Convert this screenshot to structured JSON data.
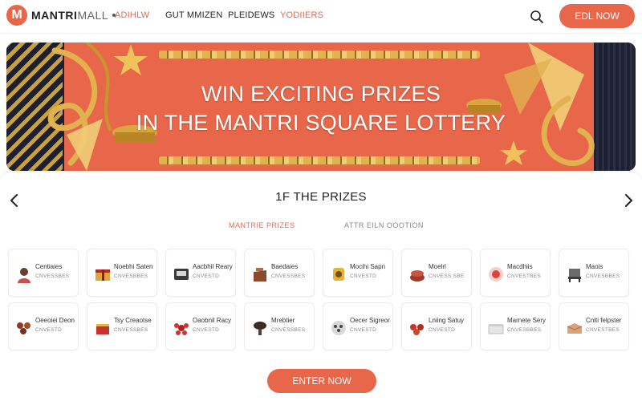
{
  "brand": {
    "badge": "M",
    "name_bold": "MANTRI",
    "name_light": "MALL"
  },
  "nav": {
    "links": [
      "ADIHLW",
      "GUT MMIZEN",
      "PLEIDEWS",
      "YODIIERS"
    ]
  },
  "header_cta": "EDL NOW",
  "hero": {
    "line1": "WIN EXCITING PRIZES",
    "line2": "IN THE MANTRI SQUARE LOTTERY"
  },
  "prizes": {
    "title": "1F THE PRIZES",
    "tabs": [
      "MANTRIE PRIZES",
      "ATTR EILN OOOTION"
    ],
    "cards": [
      {
        "name": "Centiaies",
        "sub": "CNVESSBES",
        "icon": "person-icon"
      },
      {
        "name": "Noebhi Saten",
        "sub": "CNVESBBES",
        "icon": "gift-box-icon"
      },
      {
        "name": "Aacbhil Reary",
        "sub": "CNVESTD",
        "icon": "gadget-icon"
      },
      {
        "name": "Baedaies",
        "sub": "CNVESSBES",
        "icon": "bag-icon"
      },
      {
        "name": "Mocihi Sapn",
        "sub": "CNVESTD",
        "icon": "watch-icon"
      },
      {
        "name": "Moelrl",
        "sub": "CNVESS SBE",
        "icon": "cake-icon"
      },
      {
        "name": "Macdhiis",
        "sub": "CNVESTBES",
        "icon": "ornament-icon"
      },
      {
        "name": "Maois",
        "sub": "CNVESBBES",
        "icon": "chair-icon"
      },
      {
        "name": "Oeeoiei Deon",
        "sub": "CNVESTD",
        "icon": "sweets-icon"
      },
      {
        "name": "Tsy Creaotse",
        "sub": "CNVESSBES",
        "icon": "hamper-icon"
      },
      {
        "name": "Oaobnil Racy",
        "sub": "CNVESTD",
        "icon": "flower-icon"
      },
      {
        "name": "Mrebtier",
        "sub": "CNVESSBES",
        "icon": "stand-icon"
      },
      {
        "name": "Oecer Sigreor",
        "sub": "CNVESTD",
        "icon": "tray-icon"
      },
      {
        "name": "Lniing Satuy",
        "sub": "CNVESTD",
        "icon": "fruits-icon"
      },
      {
        "name": "Marnete Sery",
        "sub": "CNVESBBES",
        "icon": "box-icon"
      },
      {
        "name": "Cnlti felpster",
        "sub": "CNVESTBES",
        "icon": "parcel-icon"
      }
    ]
  },
  "enter_cta": "ENTER NOW",
  "colors": {
    "accent": "#e8674a",
    "hero_dark": "#1d2030",
    "gold": "#e1b24d"
  }
}
